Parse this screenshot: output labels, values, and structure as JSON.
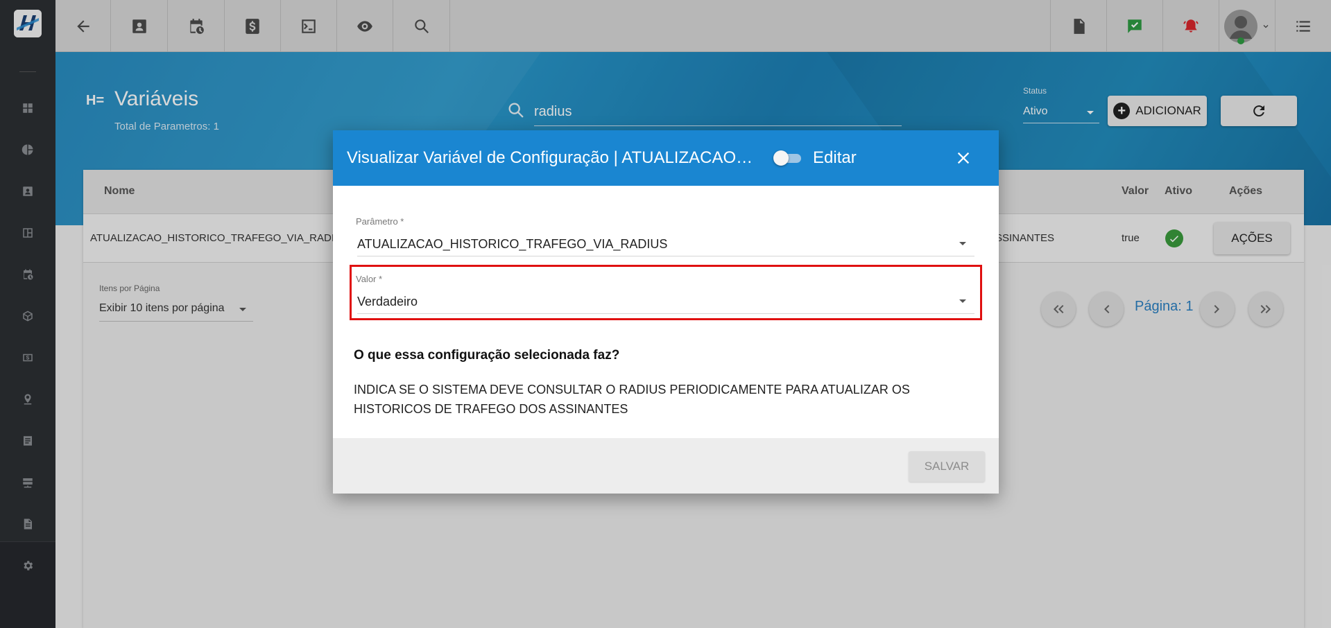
{
  "topbar": {
    "left_icons": [
      "back-arrow-icon",
      "contact-card-icon",
      "calendar-clock-icon",
      "dollar-icon",
      "terminal-icon",
      "eye-icon",
      "search-icon"
    ],
    "right_icons": [
      "pdf-icon",
      "chat-check-icon",
      "alarm-bell-icon",
      "user-avatar-icon",
      "list-menu-icon"
    ]
  },
  "sidebar": {
    "icons": [
      "dashboard-icon",
      "pie-chart-icon",
      "contact-icon",
      "board-icon",
      "calendar-clock-icon",
      "package-icon",
      "money-icon",
      "map-pin-icon",
      "list-icon",
      "server-icon",
      "document-icon",
      "gear-icon"
    ]
  },
  "header": {
    "title_icon": "H=",
    "title": "Variáveis",
    "subtitle": "Total de Parametros: 1",
    "search_value": "radius",
    "status_label": "Status",
    "status_value": "Ativo",
    "add_label": "ADICIONAR"
  },
  "table": {
    "columns": {
      "nome": "Nome",
      "valor": "Valor",
      "ativo": "Ativo",
      "acoes": "Ações"
    },
    "row": {
      "nome": "ATUALIZACAO_HISTORICO_TRAFEGO_VIA_RADIUS",
      "descricao_tail": "ASSINANTES",
      "valor": "true",
      "acoes_label": "AÇÕES"
    }
  },
  "pagination": {
    "items_label": "Itens por Página",
    "items_value": "Exibir 10 itens por página",
    "page_label": "Página: 1"
  },
  "modal": {
    "title": "Visualizar Variável de Configuração | ATUALIZACAO_HISTORICO_TRAFEGO_VIA_RADIUS",
    "edit_label": "Editar",
    "parametro_label": "Parâmetro *",
    "parametro_value": "ATUALIZACAO_HISTORICO_TRAFEGO_VIA_RADIUS",
    "valor_label": "Valor *",
    "valor_value": "Verdadeiro",
    "question": "O que essa configuração selecionada faz?",
    "description": "INDICA SE O SISTEMA DEVE CONSULTAR O RADIUS PERIODICAMENTE PARA ATUALIZAR OS HISTORICOS DE TRAFEGO DOS ASSINANTES",
    "save_label": "SALVAR"
  },
  "colors": {
    "modal_header": "#1a86d1",
    "highlight": "#e01010",
    "active_green": "#3a9a3c",
    "page_link": "#2a7fc1"
  }
}
